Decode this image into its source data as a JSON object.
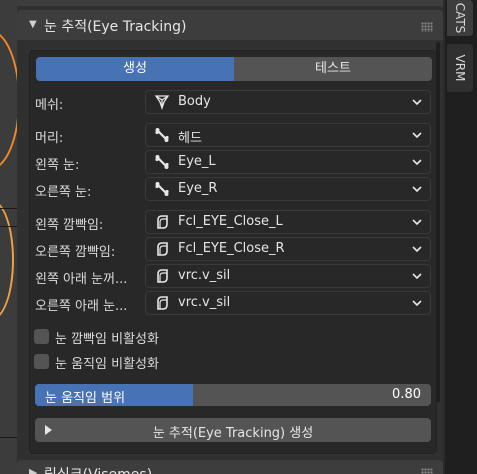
{
  "previous_panel": {
    "title": ""
  },
  "panel": {
    "title": "눈 추적(Eye Tracking)",
    "tabs": [
      {
        "label": "생성",
        "active": true
      },
      {
        "label": "테스트",
        "active": false
      }
    ],
    "fields": [
      {
        "label": "메쉬:",
        "value": "Body",
        "icon": "mesh-icon"
      },
      {
        "label": "머리:",
        "value": "헤드",
        "icon": "bone-icon"
      },
      {
        "label": "왼쪽 눈:",
        "value": "Eye_L",
        "icon": "bone-icon"
      },
      {
        "label": "오른쪽 눈:",
        "value": "Eye_R",
        "icon": "bone-icon"
      },
      {
        "label": "왼쪽 깜빡임:",
        "value": "Fcl_EYE_Close_L",
        "icon": "shape-key-icon"
      },
      {
        "label": "오른쪽 깜빡임:",
        "value": "Fcl_EYE_Close_R",
        "icon": "shape-key-icon"
      },
      {
        "label": "왼쪽 아래 눈꺼...",
        "value": "vrc.v_sil",
        "icon": "shape-key-icon"
      },
      {
        "label": "오른쪽 아래 눈...",
        "value": "vrc.v_sil",
        "icon": "shape-key-icon"
      }
    ],
    "checkboxes": [
      {
        "label": "눈 깜빡임 비활성화",
        "checked": false
      },
      {
        "label": "눈 움직임 비활성화",
        "checked": false
      }
    ],
    "slider": {
      "label": "눈 움직임 범위",
      "value": "0.80",
      "fraction": 0.4
    },
    "operator": {
      "label": "눈 추적(Eye Tracking) 생성"
    }
  },
  "next_panel": {
    "title": "립싱크(Visemes)"
  },
  "side_tabs": [
    {
      "label": "CATS",
      "active": true
    },
    {
      "label": "VRM",
      "active": false
    }
  ],
  "colors": {
    "accent": "#4772b3",
    "panel_bg": "#303030",
    "header_bg": "#3d3d3d",
    "button_bg": "#545454"
  }
}
